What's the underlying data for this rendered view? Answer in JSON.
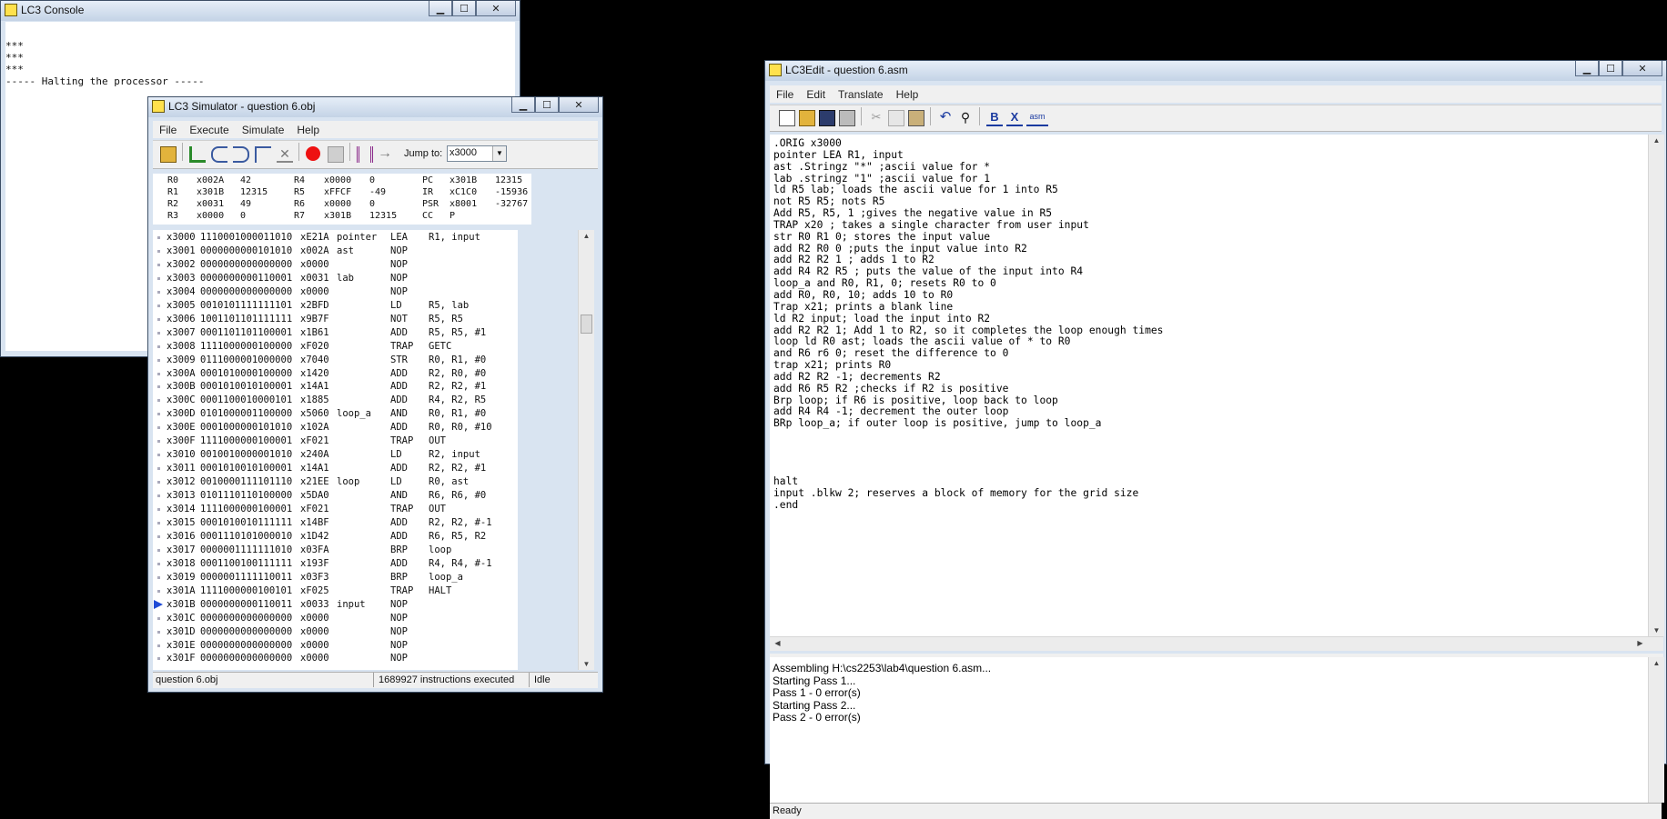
{
  "console": {
    "title": "LC3 Console",
    "output": "***\n***\n***\n----- Halting the processor -----"
  },
  "simulator": {
    "title": "LC3 Simulator - question 6.obj",
    "menu": [
      "File",
      "Execute",
      "Simulate",
      "Help"
    ],
    "jump_label": "Jump to:",
    "jump_value": "x3000",
    "registers": [
      [
        "R0",
        "x002A",
        "42",
        "R4",
        "x0000",
        "0",
        "PC",
        "x301B",
        "12315"
      ],
      [
        "R1",
        "x301B",
        "12315",
        "R5",
        "xFFCF",
        "-49",
        "IR",
        "xC1C0",
        "-15936"
      ],
      [
        "R2",
        "x0031",
        "49",
        "R6",
        "x0000",
        "0",
        "PSR",
        "x8001",
        "-32767"
      ],
      [
        "R3",
        "x0000",
        "0",
        "R7",
        "x301B",
        "12315",
        "CC",
        "P",
        ""
      ]
    ],
    "memory": [
      [
        "x3000",
        "1110001000011010",
        "xE21A",
        "pointer",
        "LEA",
        "R1, input"
      ],
      [
        "x3001",
        "0000000000101010",
        "x002A",
        "ast",
        "NOP",
        ""
      ],
      [
        "x3002",
        "0000000000000000",
        "x0000",
        "",
        "NOP",
        ""
      ],
      [
        "x3003",
        "0000000000110001",
        "x0031",
        "lab",
        "NOP",
        ""
      ],
      [
        "x3004",
        "0000000000000000",
        "x0000",
        "",
        "NOP",
        ""
      ],
      [
        "x3005",
        "0010101111111101",
        "x2BFD",
        "",
        "LD",
        "R5, lab"
      ],
      [
        "x3006",
        "1001101101111111",
        "x9B7F",
        "",
        "NOT",
        "R5, R5"
      ],
      [
        "x3007",
        "0001101101100001",
        "x1B61",
        "",
        "ADD",
        "R5, R5, #1"
      ],
      [
        "x3008",
        "1111000000100000",
        "xF020",
        "",
        "TRAP",
        "GETC"
      ],
      [
        "x3009",
        "0111000001000000",
        "x7040",
        "",
        "STR",
        "R0, R1, #0"
      ],
      [
        "x300A",
        "0001010000100000",
        "x1420",
        "",
        "ADD",
        "R2, R0, #0"
      ],
      [
        "x300B",
        "0001010010100001",
        "x14A1",
        "",
        "ADD",
        "R2, R2, #1"
      ],
      [
        "x300C",
        "0001100010000101",
        "x1885",
        "",
        "ADD",
        "R4, R2, R5"
      ],
      [
        "x300D",
        "0101000001100000",
        "x5060",
        "loop_a",
        "AND",
        "R0, R1, #0"
      ],
      [
        "x300E",
        "0001000000101010",
        "x102A",
        "",
        "ADD",
        "R0, R0, #10"
      ],
      [
        "x300F",
        "1111000000100001",
        "xF021",
        "",
        "TRAP",
        "OUT"
      ],
      [
        "x3010",
        "0010010000001010",
        "x240A",
        "",
        "LD",
        "R2, input"
      ],
      [
        "x3011",
        "0001010010100001",
        "x14A1",
        "",
        "ADD",
        "R2, R2, #1"
      ],
      [
        "x3012",
        "0010000111101110",
        "x21EE",
        "loop",
        "LD",
        "R0, ast"
      ],
      [
        "x3013",
        "0101110110100000",
        "x5DA0",
        "",
        "AND",
        "R6, R6, #0"
      ],
      [
        "x3014",
        "1111000000100001",
        "xF021",
        "",
        "TRAP",
        "OUT"
      ],
      [
        "x3015",
        "0001010010111111",
        "x14BF",
        "",
        "ADD",
        "R2, R2, #-1"
      ],
      [
        "x3016",
        "0001110101000010",
        "x1D42",
        "",
        "ADD",
        "R6, R5, R2"
      ],
      [
        "x3017",
        "0000001111111010",
        "x03FA",
        "",
        "BRP",
        "loop"
      ],
      [
        "x3018",
        "0001100100111111",
        "x193F",
        "",
        "ADD",
        "R4, R4, #-1"
      ],
      [
        "x3019",
        "0000001111110011",
        "x03F3",
        "",
        "BRP",
        "loop_a"
      ],
      [
        "x301A",
        "1111000000100101",
        "xF025",
        "",
        "TRAP",
        "HALT"
      ],
      [
        "x301B",
        "0000000000110011",
        "x0033",
        "input",
        "NOP",
        ""
      ],
      [
        "x301C",
        "0000000000000000",
        "x0000",
        "",
        "NOP",
        ""
      ],
      [
        "x301D",
        "0000000000000000",
        "x0000",
        "",
        "NOP",
        ""
      ],
      [
        "x301E",
        "0000000000000000",
        "x0000",
        "",
        "NOP",
        ""
      ],
      [
        "x301F",
        "0000000000000000",
        "x0000",
        "",
        "NOP",
        ""
      ]
    ],
    "pc_row_index": 27,
    "status_file": "question 6.obj",
    "status_count": "1689927 instructions executed",
    "status_state": "Idle"
  },
  "editor": {
    "title": "LC3Edit - question 6.asm",
    "menu": [
      "File",
      "Edit",
      "Translate",
      "Help"
    ],
    "source": ".ORIG x3000\npointer LEA R1, input\nast .Stringz \"*\" ;ascii value for *\nlab .stringz \"1\" ;ascii value for 1\nld R5 lab; loads the ascii value for 1 into R5\nnot R5 R5; nots R5\nAdd R5, R5, 1 ;gives the negative value in R5\nTRAP x20 ; takes a single character from user input\nstr R0 R1 0; stores the input value\nadd R2 R0 0 ;puts the input value into R2\nadd R2 R2 1 ; adds 1 to R2\nadd R4 R2 R5 ; puts the value of the input into R4\nloop_a and R0, R1, 0; resets R0 to 0\nadd R0, R0, 10; adds 10 to R0\nTrap x21; prints a blank line\nld R2 input; load the input into R2\nadd R2 R2 1; Add 1 to R2, so it completes the loop enough times\nloop ld R0 ast; loads the ascii value of * to R0\nand R6 r6 0; reset the difference to 0\ntrap x21; prints R0\nadd R2 R2 -1; decrements R2\nadd R6 R5 R2 ;checks if R2 is positive\nBrp loop; if R6 is positive, loop back to loop\nadd R4 R4 -1; decrement the outer loop\nBRp loop_a; if outer loop is positive, jump to loop_a\n\n\n\n\nhalt\ninput .blkw 2; reserves a block of memory for the grid size\n.end",
    "output": "Assembling H:\\cs2253\\lab4\\question 6.asm...\nStarting Pass 1...\nPass 1 - 0 error(s)\nStarting Pass 2...\nPass 2 - 0 error(s)",
    "status": "Ready"
  }
}
